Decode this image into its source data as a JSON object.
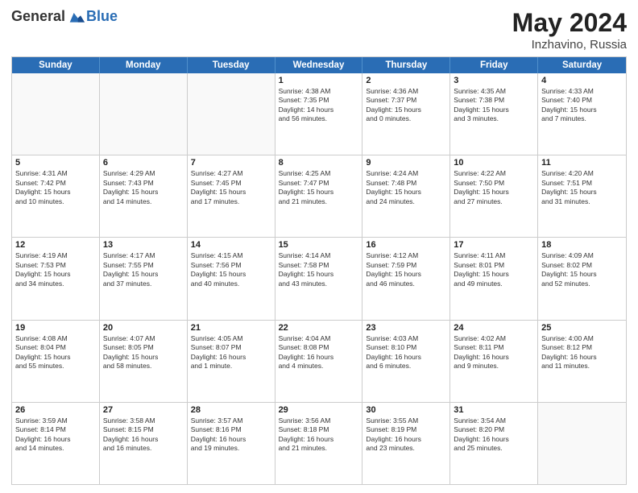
{
  "logo": {
    "general": "General",
    "blue": "Blue"
  },
  "title": {
    "month": "May 2024",
    "location": "Inzhavino, Russia"
  },
  "header": {
    "days": [
      "Sunday",
      "Monday",
      "Tuesday",
      "Wednesday",
      "Thursday",
      "Friday",
      "Saturday"
    ]
  },
  "weeks": [
    [
      {
        "day": "",
        "info": ""
      },
      {
        "day": "",
        "info": ""
      },
      {
        "day": "",
        "info": ""
      },
      {
        "day": "1",
        "info": "Sunrise: 4:38 AM\nSunset: 7:35 PM\nDaylight: 14 hours\nand 56 minutes."
      },
      {
        "day": "2",
        "info": "Sunrise: 4:36 AM\nSunset: 7:37 PM\nDaylight: 15 hours\nand 0 minutes."
      },
      {
        "day": "3",
        "info": "Sunrise: 4:35 AM\nSunset: 7:38 PM\nDaylight: 15 hours\nand 3 minutes."
      },
      {
        "day": "4",
        "info": "Sunrise: 4:33 AM\nSunset: 7:40 PM\nDaylight: 15 hours\nand 7 minutes."
      }
    ],
    [
      {
        "day": "5",
        "info": "Sunrise: 4:31 AM\nSunset: 7:42 PM\nDaylight: 15 hours\nand 10 minutes."
      },
      {
        "day": "6",
        "info": "Sunrise: 4:29 AM\nSunset: 7:43 PM\nDaylight: 15 hours\nand 14 minutes."
      },
      {
        "day": "7",
        "info": "Sunrise: 4:27 AM\nSunset: 7:45 PM\nDaylight: 15 hours\nand 17 minutes."
      },
      {
        "day": "8",
        "info": "Sunrise: 4:25 AM\nSunset: 7:47 PM\nDaylight: 15 hours\nand 21 minutes."
      },
      {
        "day": "9",
        "info": "Sunrise: 4:24 AM\nSunset: 7:48 PM\nDaylight: 15 hours\nand 24 minutes."
      },
      {
        "day": "10",
        "info": "Sunrise: 4:22 AM\nSunset: 7:50 PM\nDaylight: 15 hours\nand 27 minutes."
      },
      {
        "day": "11",
        "info": "Sunrise: 4:20 AM\nSunset: 7:51 PM\nDaylight: 15 hours\nand 31 minutes."
      }
    ],
    [
      {
        "day": "12",
        "info": "Sunrise: 4:19 AM\nSunset: 7:53 PM\nDaylight: 15 hours\nand 34 minutes."
      },
      {
        "day": "13",
        "info": "Sunrise: 4:17 AM\nSunset: 7:55 PM\nDaylight: 15 hours\nand 37 minutes."
      },
      {
        "day": "14",
        "info": "Sunrise: 4:15 AM\nSunset: 7:56 PM\nDaylight: 15 hours\nand 40 minutes."
      },
      {
        "day": "15",
        "info": "Sunrise: 4:14 AM\nSunset: 7:58 PM\nDaylight: 15 hours\nand 43 minutes."
      },
      {
        "day": "16",
        "info": "Sunrise: 4:12 AM\nSunset: 7:59 PM\nDaylight: 15 hours\nand 46 minutes."
      },
      {
        "day": "17",
        "info": "Sunrise: 4:11 AM\nSunset: 8:01 PM\nDaylight: 15 hours\nand 49 minutes."
      },
      {
        "day": "18",
        "info": "Sunrise: 4:09 AM\nSunset: 8:02 PM\nDaylight: 15 hours\nand 52 minutes."
      }
    ],
    [
      {
        "day": "19",
        "info": "Sunrise: 4:08 AM\nSunset: 8:04 PM\nDaylight: 15 hours\nand 55 minutes."
      },
      {
        "day": "20",
        "info": "Sunrise: 4:07 AM\nSunset: 8:05 PM\nDaylight: 15 hours\nand 58 minutes."
      },
      {
        "day": "21",
        "info": "Sunrise: 4:05 AM\nSunset: 8:07 PM\nDaylight: 16 hours\nand 1 minute."
      },
      {
        "day": "22",
        "info": "Sunrise: 4:04 AM\nSunset: 8:08 PM\nDaylight: 16 hours\nand 4 minutes."
      },
      {
        "day": "23",
        "info": "Sunrise: 4:03 AM\nSunset: 8:10 PM\nDaylight: 16 hours\nand 6 minutes."
      },
      {
        "day": "24",
        "info": "Sunrise: 4:02 AM\nSunset: 8:11 PM\nDaylight: 16 hours\nand 9 minutes."
      },
      {
        "day": "25",
        "info": "Sunrise: 4:00 AM\nSunset: 8:12 PM\nDaylight: 16 hours\nand 11 minutes."
      }
    ],
    [
      {
        "day": "26",
        "info": "Sunrise: 3:59 AM\nSunset: 8:14 PM\nDaylight: 16 hours\nand 14 minutes."
      },
      {
        "day": "27",
        "info": "Sunrise: 3:58 AM\nSunset: 8:15 PM\nDaylight: 16 hours\nand 16 minutes."
      },
      {
        "day": "28",
        "info": "Sunrise: 3:57 AM\nSunset: 8:16 PM\nDaylight: 16 hours\nand 19 minutes."
      },
      {
        "day": "29",
        "info": "Sunrise: 3:56 AM\nSunset: 8:18 PM\nDaylight: 16 hours\nand 21 minutes."
      },
      {
        "day": "30",
        "info": "Sunrise: 3:55 AM\nSunset: 8:19 PM\nDaylight: 16 hours\nand 23 minutes."
      },
      {
        "day": "31",
        "info": "Sunrise: 3:54 AM\nSunset: 8:20 PM\nDaylight: 16 hours\nand 25 minutes."
      },
      {
        "day": "",
        "info": ""
      }
    ]
  ]
}
